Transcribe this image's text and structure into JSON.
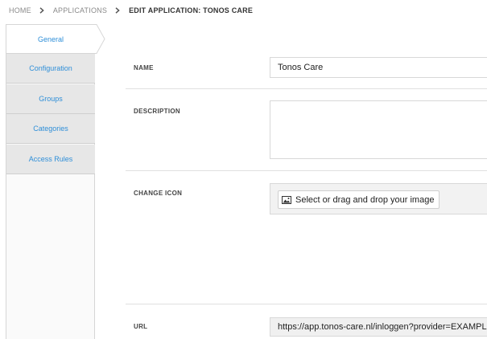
{
  "breadcrumb": {
    "home": "Home",
    "applications": "Applications",
    "current": "Edit application: Tonos Care"
  },
  "tabs": [
    {
      "label": "General",
      "active": true
    },
    {
      "label": "Configuration",
      "active": false
    },
    {
      "label": "Groups",
      "active": false
    },
    {
      "label": "Categories",
      "active": false
    },
    {
      "label": "Access Rules",
      "active": false
    }
  ],
  "form": {
    "name_label": "Name",
    "name_value": "Tonos Care",
    "description_label": "Description",
    "description_value": "",
    "icon_label": "Change icon",
    "icon_button_label": "Select or drag and drop your image",
    "url_label": "URL",
    "url_value": "https://app.tonos-care.nl/inloggen?provider=EXAMPLE"
  },
  "colors": {
    "tab_text": "#2f8fd8",
    "tab_inactive_bg": "#e7e7e7",
    "divider": "#e0e0e0"
  },
  "icons": {
    "breadcrumb_separator": "chevron-right-icon",
    "upload": "image-icon"
  }
}
